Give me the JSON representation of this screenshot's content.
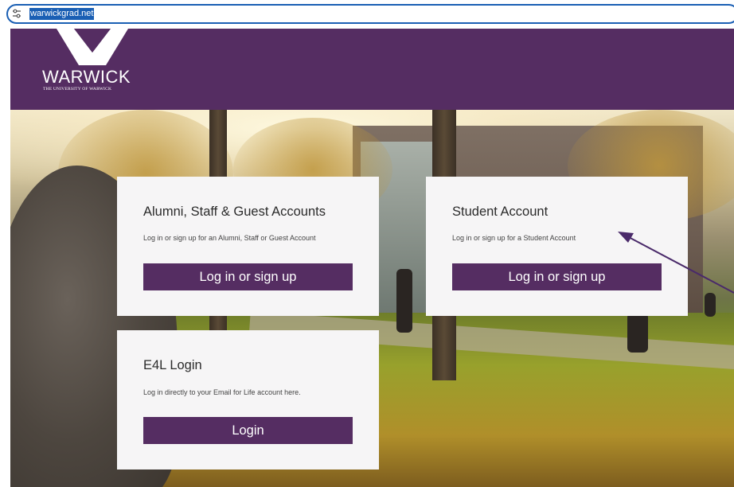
{
  "browser": {
    "url": "warwickgrad.net",
    "icons": {
      "site_info": "tune-icon"
    },
    "colors": {
      "url_highlight": "#1a5fb4"
    }
  },
  "header": {
    "logo_word": "WARWICK",
    "logo_sub": "THE UNIVERSITY OF WARWICK",
    "colors": {
      "brand_purple": "#552d62"
    }
  },
  "cards": {
    "alumni": {
      "title": "Alumni, Staff & Guest Accounts",
      "description": "Log in or sign up for an Alumni, Staff or Guest Account",
      "button_label": "Log in or sign up"
    },
    "student": {
      "title": "Student Account",
      "description": "Log in or sign up for a Student Account",
      "button_label": "Log in or sign up"
    },
    "e4l": {
      "title": "E4L Login",
      "description": "Log in directly to your Email for Life account here.",
      "button_label": "Login"
    }
  },
  "annotation": {
    "icon": "arrow-annotation",
    "color": "#4a2a6a"
  }
}
